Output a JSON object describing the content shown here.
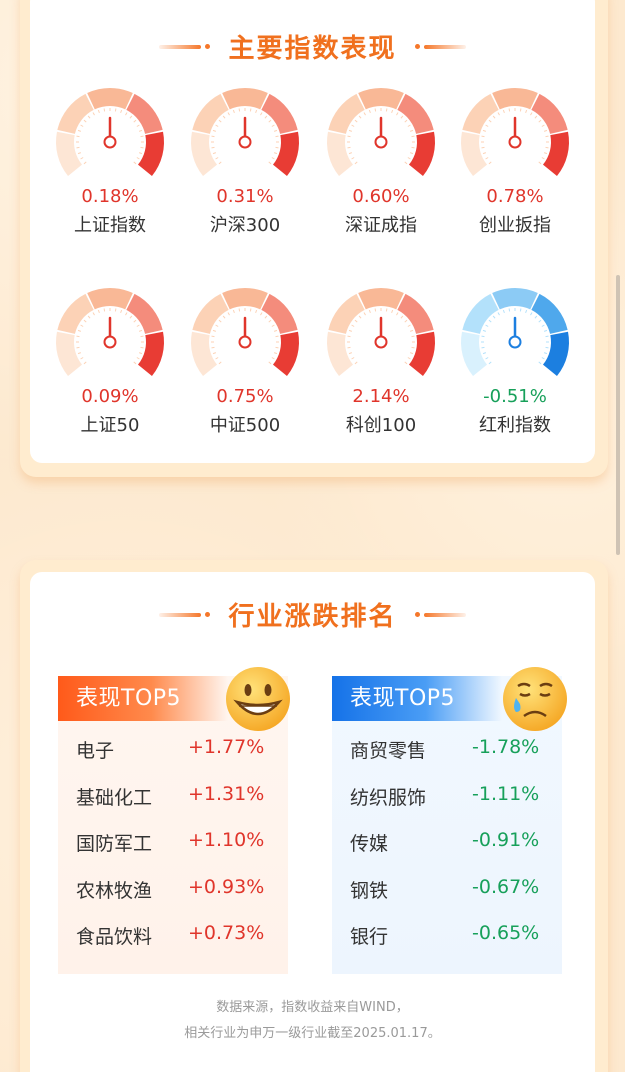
{
  "indices_section": {
    "title": "主要指数表现",
    "items": [
      {
        "name": "上证指数",
        "value": "0.18%",
        "trend": "up"
      },
      {
        "name": "沪深300",
        "value": "0.31%",
        "trend": "up"
      },
      {
        "name": "深证成指",
        "value": "0.60%",
        "trend": "up"
      },
      {
        "name": "创业扳指",
        "value": "0.78%",
        "trend": "up"
      },
      {
        "name": "上证50",
        "value": "0.09%",
        "trend": "up"
      },
      {
        "name": "中证500",
        "value": "0.75%",
        "trend": "up"
      },
      {
        "name": "科创100",
        "value": "2.14%",
        "trend": "up"
      },
      {
        "name": "红利指数",
        "value": "-0.51%",
        "trend": "down"
      }
    ]
  },
  "industry_section": {
    "title": "行业涨跌排名",
    "gainers": {
      "header": "表现TOP5",
      "emoji": "grinning-face-icon",
      "rows": [
        {
          "name": "电子",
          "value": "+1.77%"
        },
        {
          "name": "基础化工",
          "value": "+1.31%"
        },
        {
          "name": "国防军工",
          "value": "+1.10%"
        },
        {
          "name": "农林牧渔",
          "value": "+0.93%"
        },
        {
          "name": "食品饮料",
          "value": "+0.73%"
        }
      ]
    },
    "losers": {
      "header": "表现TOP5",
      "emoji": "crying-face-icon",
      "rows": [
        {
          "name": "商贸零售",
          "value": "-1.78%"
        },
        {
          "name": "纺织服饰",
          "value": "-1.11%"
        },
        {
          "name": "传媒",
          "value": "-0.91%"
        },
        {
          "name": "钢铁",
          "value": "-0.67%"
        },
        {
          "name": "银行",
          "value": "-0.65%"
        }
      ]
    },
    "footnote_line1": "数据来源，指数收益来自WIND，",
    "footnote_line2": "相关行业为申万一级行业截至2025.01.17。"
  },
  "colors": {
    "accent": "#f0701e",
    "up": "#e0352b",
    "down": "#17a05a",
    "gainer_header": "#ff5a1a",
    "loser_header": "#1572e8"
  }
}
